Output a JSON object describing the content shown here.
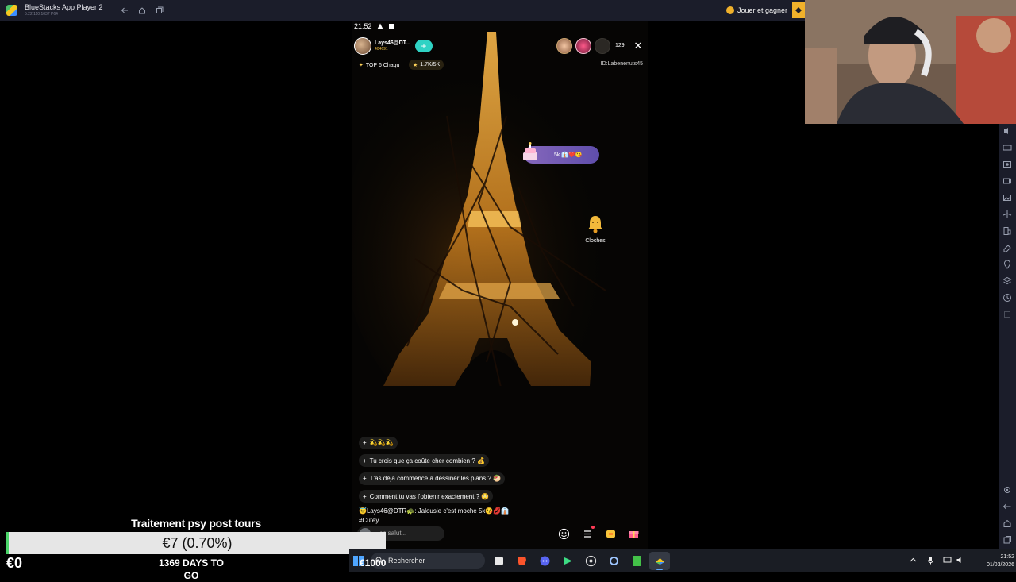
{
  "window": {
    "app_title": "BlueStacks App Player 2",
    "app_version": "5.22.110.1037 P64",
    "play_and_earn_label": "Jouer et gagner"
  },
  "phone": {
    "status": {
      "time": "21:52"
    },
    "host": {
      "name": "Lays46@DT...",
      "id": "404691"
    },
    "follow_label": "+",
    "viewer_count": "129",
    "close_label": "✕",
    "rank_label": "TOP 6 Chaqu",
    "score_label": "1.7K/5K",
    "stream_id": "ID:Labenenuts45",
    "gift_banner_text": "5k 👔❤️😘",
    "bell_label": "Cloches",
    "comments": [
      {
        "text": "💫💫💫"
      },
      {
        "text": "Tu crois que ça coûte cher combien ? 💰"
      },
      {
        "text": "T'as déjà commencé à dessiner les plans ? 🥙"
      },
      {
        "text": "Comment tu vas l'obtenir exactement ? 😳"
      }
    ],
    "chat_message": {
      "user": "😇Lays46@DTR🐢:",
      "text": " Jalousie c'est moche 5k😘💋👔",
      "tag": "#Cutey"
    },
    "say_placeholder": "es salut..."
  },
  "overlay": {
    "title": "Traitement psy post tours",
    "value": "€7 (0.70%)",
    "left_amount": "€0",
    "days_to_go": "1369 DAYS TO GO",
    "right_amount": "€1000"
  },
  "taskbar": {
    "search_label": "Rechercher",
    "badge_count": "99",
    "time": "21:52",
    "date": "01/03/2026"
  }
}
